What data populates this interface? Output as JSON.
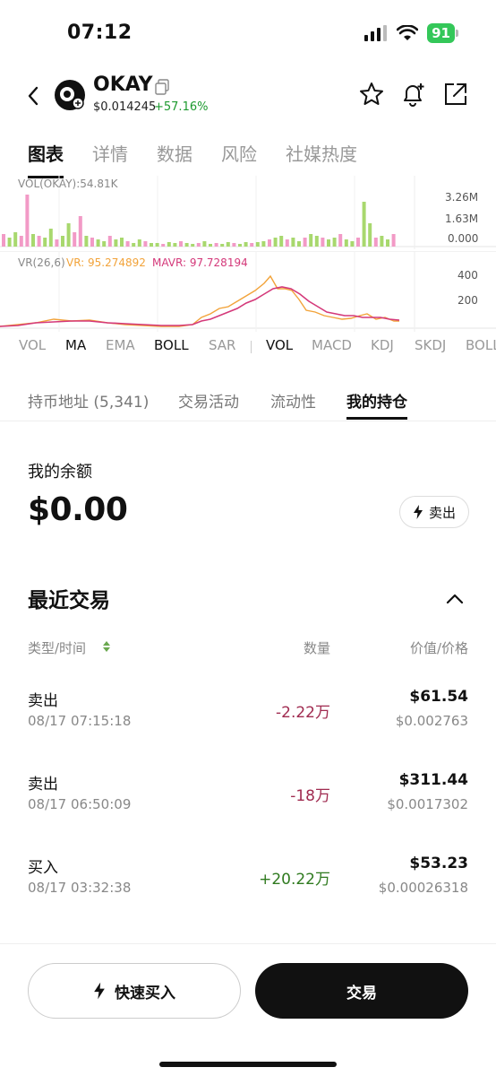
{
  "status_bar": {
    "time": "07:12",
    "battery": "91"
  },
  "header": {
    "token_name": "OKAY",
    "price": "$0.014245",
    "change": "+57.16%"
  },
  "main_tabs": [
    "图表",
    "详情",
    "数据",
    "风险",
    "社媒热度"
  ],
  "vol_chart": {
    "label": "VOL(OKAY):54.81K",
    "axis": [
      "3.26M",
      "1.63M",
      "0.000"
    ]
  },
  "vr_chart": {
    "label_prefix": "VR(26,6)",
    "vr": "VR: 95.274892",
    "mavr": "MAVR: 97.728194",
    "axis": [
      "400",
      "200"
    ]
  },
  "indicators": {
    "main": [
      "VOL",
      "MA",
      "EMA",
      "BOLL",
      "SAR"
    ],
    "sub": [
      "VOL",
      "MACD",
      "KDJ",
      "SKDJ",
      "BOLL"
    ]
  },
  "sub_tabs": [
    "持币地址 (5,341)",
    "交易活动",
    "流动性",
    "我的持仓"
  ],
  "balance": {
    "label": "我的余额",
    "value": "$0.00",
    "sell_label": "卖出"
  },
  "recent": {
    "title": "最近交易",
    "columns": [
      "类型/时间",
      "数量",
      "价值/价格"
    ],
    "trades": [
      {
        "type": "卖出",
        "time": "08/17 07:15:18",
        "qty": "-2.22万",
        "value": "$61.54",
        "price": "$0.002763"
      },
      {
        "type": "卖出",
        "time": "08/17 06:50:09",
        "qty": "-18万",
        "value": "$311.44",
        "price": "$0.0017302"
      },
      {
        "type": "买入",
        "time": "08/17 03:32:38",
        "qty": "+20.22万",
        "value": "$53.23",
        "price": "$0.00026318"
      }
    ]
  },
  "bottom": {
    "quick_buy": "快速买入",
    "trade": "交易"
  },
  "colors": {
    "vr_line": "#f2a33a",
    "mavr_line": "#d4397a",
    "vol_up": "#a8d86e",
    "vol_down": "#f29ac6",
    "positive": "#1d9a2f",
    "negative": "#a02b50"
  }
}
